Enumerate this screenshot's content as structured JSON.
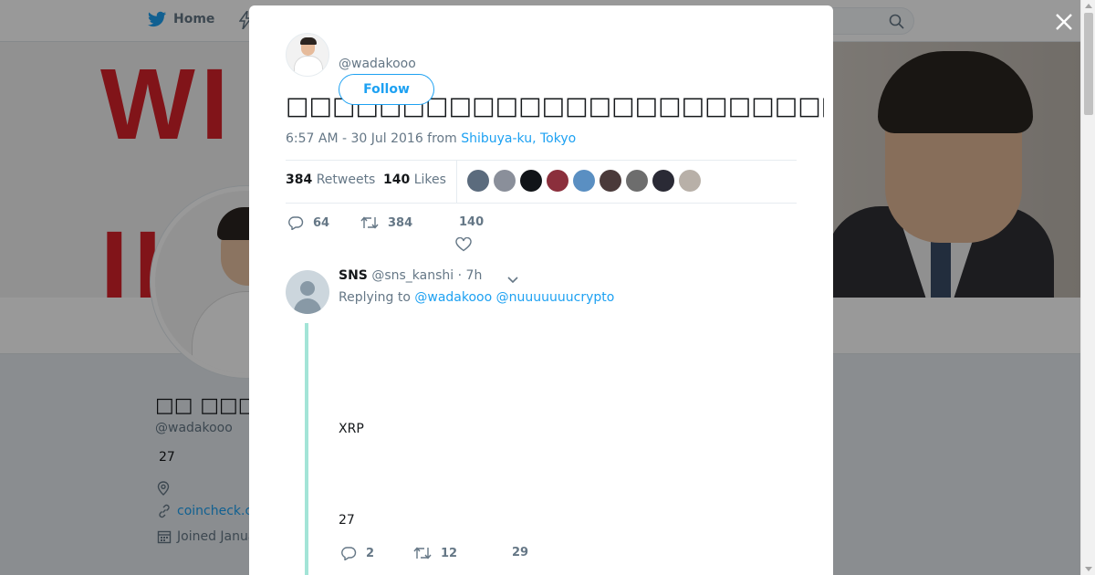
{
  "nav": {
    "home_label": "Home"
  },
  "profile": {
    "name": "□□ □□□",
    "handle": "@wadakooo",
    "bio": "27",
    "link": "coincheck.c",
    "joined": "Joined Janua",
    "banner_text_top": "WI",
    "banner_text_bottom": "II"
  },
  "tweet": {
    "handle": "@wadakooo",
    "follow_label": "Follow",
    "text": "□□□□□□□□□□□□□□□□□□□□□□□□□□□□□□□…□□□□□□□",
    "timestamp": "6:57 AM - 30 Jul 2016 from ",
    "location": "Shibuya-ku, Tokyo",
    "retweets_count": "384",
    "retweets_label": "Retweets",
    "likes_count": "140",
    "likes_label": "Likes",
    "likers": [
      "#5b6b7d",
      "#8a8f9a",
      "#111418",
      "#8b2f3c",
      "#5a8fc2",
      "#4a3a3a",
      "#6d6d6d",
      "#2a2a35",
      "#b8b0a8"
    ],
    "reply_count": "64",
    "retweet_count": "384",
    "like_count": "140"
  },
  "reply": {
    "name": "SNS",
    "handle": "@sns_kanshi",
    "time": "· 7h",
    "replying_prefix": "Replying to ",
    "mention1": "@wadakooo",
    "mention2": "@nuuuuuuucrypto",
    "line1": "XRP",
    "line2": "27",
    "reply_count": "2",
    "retweet_count": "12",
    "like_count": "29"
  },
  "colors": {
    "accent": "#1da1f2",
    "thread": "#a3e4d7"
  }
}
